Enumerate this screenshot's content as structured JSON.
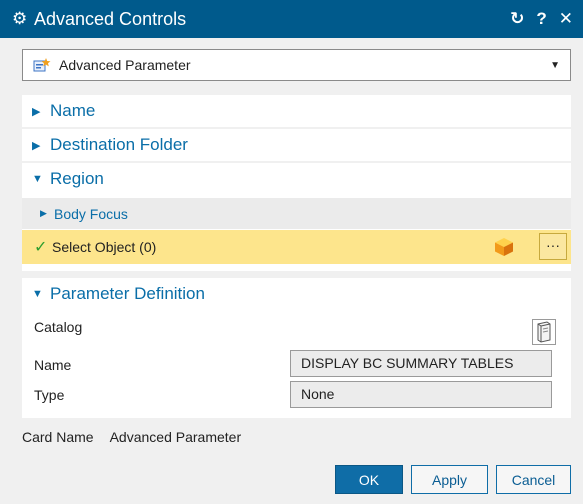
{
  "window": {
    "title": "Advanced Controls",
    "buttons": {
      "reset": "↻",
      "help": "?",
      "close": "✕"
    }
  },
  "type_selector": {
    "value": "Advanced Parameter"
  },
  "sections": {
    "name": {
      "label": "Name",
      "expanded": false
    },
    "destination_folder": {
      "label": "Destination Folder",
      "expanded": false
    },
    "region": {
      "label": "Region",
      "expanded": true,
      "body_focus": {
        "label": "Body Focus",
        "expanded": false
      },
      "select_object": {
        "label": "Select Object (0)",
        "more_label": "···"
      }
    },
    "parameter_definition": {
      "label": "Parameter Definition",
      "expanded": true,
      "catalog": {
        "label": "Catalog"
      },
      "name": {
        "label": "Name",
        "value": "DISPLAY BC SUMMARY TABLES"
      },
      "type": {
        "label": "Type",
        "value": "None"
      }
    }
  },
  "card": {
    "label": "Card Name",
    "value": "Advanced Parameter"
  },
  "footer": {
    "ok": "OK",
    "apply": "Apply",
    "cancel": "Cancel"
  },
  "colors": {
    "titlebar": "#005a8c",
    "section_header_text": "#0a6ea8",
    "selection_highlight": "#fde58c",
    "primary_button": "#0f6da7"
  }
}
